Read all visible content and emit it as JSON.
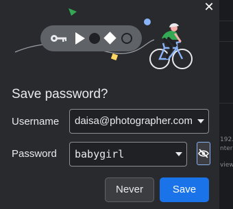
{
  "dialog": {
    "title": "Save password?",
    "close_glyph": "✕",
    "username": {
      "label": "Username",
      "value": "daisa@photographer.com"
    },
    "password": {
      "label": "Password",
      "value": "babygirl"
    },
    "buttons": {
      "never": "Never",
      "save": "Save"
    }
  },
  "background": {
    "fragments": [
      "192.",
      "ntern",
      "view"
    ]
  },
  "icons": {
    "close": "close-icon",
    "dropdown": "chevron-down-icon",
    "visibility": "eye-off-icon",
    "key": "key-icon",
    "illustration": "cyclist-illustration"
  },
  "colors": {
    "popup_bg": "#292a2d",
    "primary": "#1a73e8",
    "accent_blue": "#8ab4f8",
    "green": "#34a853",
    "yellow": "#fdd663",
    "text": "#e8eaed"
  }
}
